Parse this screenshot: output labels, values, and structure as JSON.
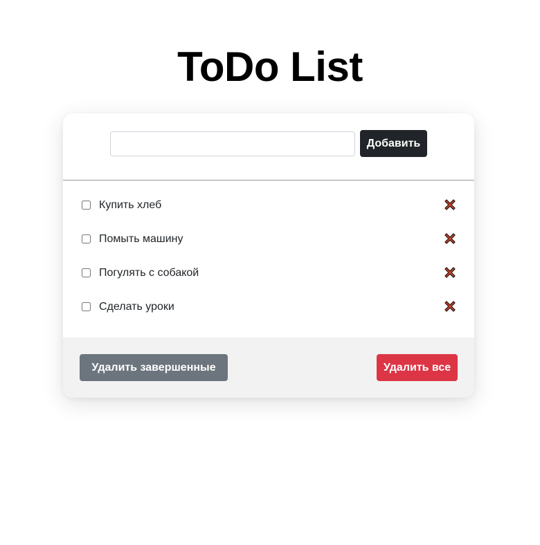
{
  "header": {
    "title": "ToDo List"
  },
  "add_form": {
    "input_value": "",
    "input_placeholder": "",
    "add_label": "Добавить"
  },
  "tasks": [
    {
      "label": "Купить хлеб",
      "done": false,
      "delete_icon": "red-x-icon"
    },
    {
      "label": "Помыть машину",
      "done": false,
      "delete_icon": "red-x-icon"
    },
    {
      "label": "Погулять с собакой",
      "done": false,
      "delete_icon": "red-x-icon"
    },
    {
      "label": "Сделать уроки",
      "done": false,
      "delete_icon": "red-x-icon"
    }
  ],
  "footer": {
    "clear_completed_label": "Удалить завершенные",
    "clear_all_label": "Удалить все"
  },
  "colors": {
    "add_button": "#212529",
    "clear_completed_button": "#6c757d",
    "clear_all_button": "#dc3545",
    "delete_icon": "#e0462f",
    "footer_background": "#f2f2f2"
  }
}
